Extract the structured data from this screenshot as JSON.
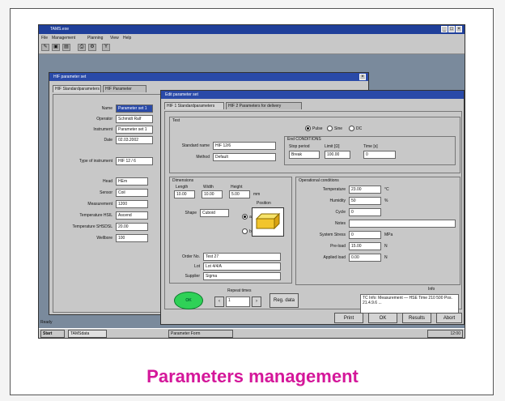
{
  "app": {
    "title": "TAMS.exe",
    "menu": [
      "File",
      "Management",
      "Planning",
      "View",
      "Help"
    ]
  },
  "bg_window": {
    "title": "HIF parameter set",
    "tabs": [
      "HIF Standardparameters",
      "HIF Parameter"
    ],
    "fields": [
      {
        "label": "Name",
        "value": "Parameter set 1"
      },
      {
        "label": "Operator",
        "value": "Schmidt Ralf"
      },
      {
        "label": "Instrument",
        "value": "Parameter set 1"
      },
      {
        "label": "Date",
        "value": "02.03.2002"
      },
      {
        "label": "Type of instrument",
        "value": "HIF 12 / 6"
      },
      {
        "label": "Head",
        "value": "HEm"
      },
      {
        "label": "Sensor",
        "value": "Coil"
      },
      {
        "label": "Measurement",
        "value": "1200"
      },
      {
        "label": "Temperature HSIL",
        "value": "Ascend"
      },
      {
        "label": "Temperature SHSDSL",
        "value": "20.00"
      },
      {
        "label": "Wellbore",
        "value": "100"
      }
    ]
  },
  "fg_window": {
    "title": "Edit parameter set",
    "tabs": [
      "HIF 1 Standardparameters",
      "HIF 2 Parameters for delivery"
    ],
    "general": {
      "legend": "Test",
      "standard_label": "Standard name",
      "standard_value": "HIF 12/6",
      "method_label": "Method",
      "method_value": "Default",
      "modes": [
        "Pulse",
        "Sine",
        "DC"
      ],
      "selected_mode": "Pulse"
    },
    "end_conditions": {
      "legend": "End CONDITIONS",
      "cols": [
        "Stop period",
        "Limit [Ω]",
        "Time [s]"
      ],
      "values": [
        "Break",
        "100.00",
        "0"
      ]
    },
    "dimensions": {
      "legend": "Dimensions",
      "cols": [
        "Length",
        "Width",
        "Height"
      ],
      "values": [
        "10.00",
        "10.00",
        "5.00"
      ],
      "unit": "mm",
      "sketch_label": "Position",
      "shape_label": "Shape",
      "shape_value": "Cuboid",
      "radio_a": "a",
      "radio_b": "b",
      "radio_b_value": "-"
    },
    "order": [
      {
        "label": "Order No.",
        "value": "Test 27"
      },
      {
        "label": "Lot",
        "value": "Lot 4/4/A"
      },
      {
        "label": "Supplier",
        "value": "Sigma"
      }
    ],
    "conditions": {
      "legend": "Operational conditions",
      "rows": [
        {
          "label": "Temperature",
          "value": "23.00",
          "unit": "°C"
        },
        {
          "label": "Humidity",
          "value": "50",
          "unit": "%"
        },
        {
          "label": "Cycle",
          "value": "0",
          "unit": ""
        },
        {
          "label": "Notes",
          "value": "",
          "unit": ""
        },
        {
          "label": "System Stress",
          "value": "0",
          "unit": "MPa"
        },
        {
          "label": "Pre-load",
          "value": "15.00",
          "unit": "N"
        },
        {
          "label": "Applied load",
          "value": "0.00",
          "unit": "N"
        }
      ]
    },
    "notes_label": "Info",
    "notes_text": "TC Info: Measurement — HSE  Time  210  500  Pos. 21.4.9.6 ...",
    "ok_badge": "OK",
    "repeat_label": "Repeat times",
    "repeat_value": "1",
    "reg_label": "Reg. data",
    "buttons": [
      "Print",
      "OK",
      "Results",
      "Abort"
    ]
  },
  "taskbar": {
    "start": "Start",
    "items": [
      "TAMSdata",
      "Parameter Form"
    ],
    "status": "Ready",
    "clock": "12:00"
  },
  "caption": "Parameters management"
}
